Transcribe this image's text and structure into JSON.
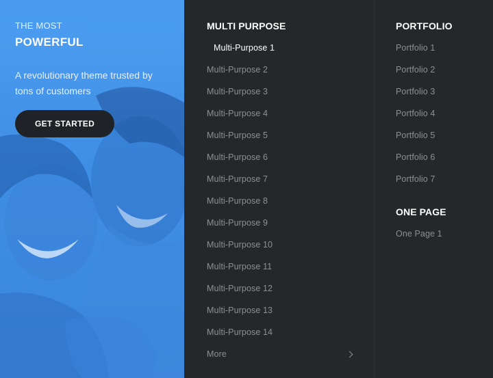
{
  "promo": {
    "eyebrow": "THE MOST",
    "headline": "POWERFUL",
    "description": "A revolutionary theme trusted by tons of customers",
    "cta_label": "GET STARTED"
  },
  "columns": [
    {
      "heading": "MULTI PURPOSE",
      "items": [
        "Multi-Purpose 1",
        "Multi-Purpose 2",
        "Multi-Purpose 3",
        "Multi-Purpose 4",
        "Multi-Purpose 5",
        "Multi-Purpose 6",
        "Multi-Purpose 7",
        "Multi-Purpose 8",
        "Multi-Purpose 9",
        "Multi-Purpose 10",
        "Multi-Purpose 11",
        "Multi-Purpose 12",
        "Multi-Purpose 13",
        "Multi-Purpose 14"
      ],
      "active_item": "Multi-Purpose 1",
      "more_label": "More"
    },
    {
      "heading": "PORTFOLIO",
      "items": [
        "Portfolio 1",
        "Portfolio 2",
        "Portfolio 3",
        "Portfolio 4",
        "Portfolio 5",
        "Portfolio 6",
        "Portfolio 7"
      ]
    },
    {
      "heading": "ONE PAGE",
      "items": [
        "One Page 1"
      ]
    }
  ],
  "colors": {
    "accent_blue": "#4096eb",
    "menu_bg": "#24282b",
    "link_gray": "#8a9095",
    "button_dark": "#1f2327"
  }
}
